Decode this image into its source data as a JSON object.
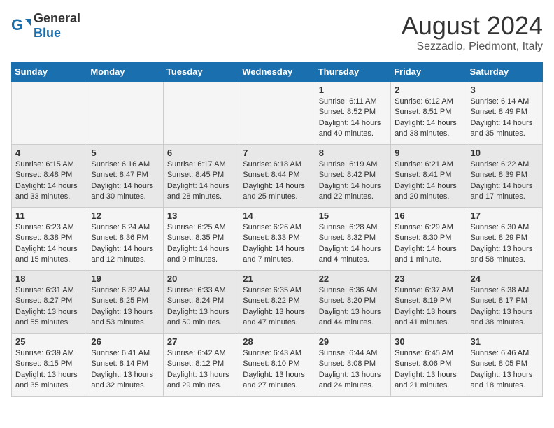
{
  "header": {
    "logo_general": "General",
    "logo_blue": "Blue",
    "title": "August 2024",
    "subtitle": "Sezzadio, Piedmont, Italy"
  },
  "weekdays": [
    "Sunday",
    "Monday",
    "Tuesday",
    "Wednesday",
    "Thursday",
    "Friday",
    "Saturday"
  ],
  "weeks": [
    [
      {
        "day": "",
        "info": ""
      },
      {
        "day": "",
        "info": ""
      },
      {
        "day": "",
        "info": ""
      },
      {
        "day": "",
        "info": ""
      },
      {
        "day": "1",
        "info": "Sunrise: 6:11 AM\nSunset: 8:52 PM\nDaylight: 14 hours\nand 40 minutes."
      },
      {
        "day": "2",
        "info": "Sunrise: 6:12 AM\nSunset: 8:51 PM\nDaylight: 14 hours\nand 38 minutes."
      },
      {
        "day": "3",
        "info": "Sunrise: 6:14 AM\nSunset: 8:49 PM\nDaylight: 14 hours\nand 35 minutes."
      }
    ],
    [
      {
        "day": "4",
        "info": "Sunrise: 6:15 AM\nSunset: 8:48 PM\nDaylight: 14 hours\nand 33 minutes."
      },
      {
        "day": "5",
        "info": "Sunrise: 6:16 AM\nSunset: 8:47 PM\nDaylight: 14 hours\nand 30 minutes."
      },
      {
        "day": "6",
        "info": "Sunrise: 6:17 AM\nSunset: 8:45 PM\nDaylight: 14 hours\nand 28 minutes."
      },
      {
        "day": "7",
        "info": "Sunrise: 6:18 AM\nSunset: 8:44 PM\nDaylight: 14 hours\nand 25 minutes."
      },
      {
        "day": "8",
        "info": "Sunrise: 6:19 AM\nSunset: 8:42 PM\nDaylight: 14 hours\nand 22 minutes."
      },
      {
        "day": "9",
        "info": "Sunrise: 6:21 AM\nSunset: 8:41 PM\nDaylight: 14 hours\nand 20 minutes."
      },
      {
        "day": "10",
        "info": "Sunrise: 6:22 AM\nSunset: 8:39 PM\nDaylight: 14 hours\nand 17 minutes."
      }
    ],
    [
      {
        "day": "11",
        "info": "Sunrise: 6:23 AM\nSunset: 8:38 PM\nDaylight: 14 hours\nand 15 minutes."
      },
      {
        "day": "12",
        "info": "Sunrise: 6:24 AM\nSunset: 8:36 PM\nDaylight: 14 hours\nand 12 minutes."
      },
      {
        "day": "13",
        "info": "Sunrise: 6:25 AM\nSunset: 8:35 PM\nDaylight: 14 hours\nand 9 minutes."
      },
      {
        "day": "14",
        "info": "Sunrise: 6:26 AM\nSunset: 8:33 PM\nDaylight: 14 hours\nand 7 minutes."
      },
      {
        "day": "15",
        "info": "Sunrise: 6:28 AM\nSunset: 8:32 PM\nDaylight: 14 hours\nand 4 minutes."
      },
      {
        "day": "16",
        "info": "Sunrise: 6:29 AM\nSunset: 8:30 PM\nDaylight: 14 hours\nand 1 minute."
      },
      {
        "day": "17",
        "info": "Sunrise: 6:30 AM\nSunset: 8:29 PM\nDaylight: 13 hours\nand 58 minutes."
      }
    ],
    [
      {
        "day": "18",
        "info": "Sunrise: 6:31 AM\nSunset: 8:27 PM\nDaylight: 13 hours\nand 55 minutes."
      },
      {
        "day": "19",
        "info": "Sunrise: 6:32 AM\nSunset: 8:25 PM\nDaylight: 13 hours\nand 53 minutes."
      },
      {
        "day": "20",
        "info": "Sunrise: 6:33 AM\nSunset: 8:24 PM\nDaylight: 13 hours\nand 50 minutes."
      },
      {
        "day": "21",
        "info": "Sunrise: 6:35 AM\nSunset: 8:22 PM\nDaylight: 13 hours\nand 47 minutes."
      },
      {
        "day": "22",
        "info": "Sunrise: 6:36 AM\nSunset: 8:20 PM\nDaylight: 13 hours\nand 44 minutes."
      },
      {
        "day": "23",
        "info": "Sunrise: 6:37 AM\nSunset: 8:19 PM\nDaylight: 13 hours\nand 41 minutes."
      },
      {
        "day": "24",
        "info": "Sunrise: 6:38 AM\nSunset: 8:17 PM\nDaylight: 13 hours\nand 38 minutes."
      }
    ],
    [
      {
        "day": "25",
        "info": "Sunrise: 6:39 AM\nSunset: 8:15 PM\nDaylight: 13 hours\nand 35 minutes."
      },
      {
        "day": "26",
        "info": "Sunrise: 6:41 AM\nSunset: 8:14 PM\nDaylight: 13 hours\nand 32 minutes."
      },
      {
        "day": "27",
        "info": "Sunrise: 6:42 AM\nSunset: 8:12 PM\nDaylight: 13 hours\nand 29 minutes."
      },
      {
        "day": "28",
        "info": "Sunrise: 6:43 AM\nSunset: 8:10 PM\nDaylight: 13 hours\nand 27 minutes."
      },
      {
        "day": "29",
        "info": "Sunrise: 6:44 AM\nSunset: 8:08 PM\nDaylight: 13 hours\nand 24 minutes."
      },
      {
        "day": "30",
        "info": "Sunrise: 6:45 AM\nSunset: 8:06 PM\nDaylight: 13 hours\nand 21 minutes."
      },
      {
        "day": "31",
        "info": "Sunrise: 6:46 AM\nSunset: 8:05 PM\nDaylight: 13 hours\nand 18 minutes."
      }
    ]
  ]
}
